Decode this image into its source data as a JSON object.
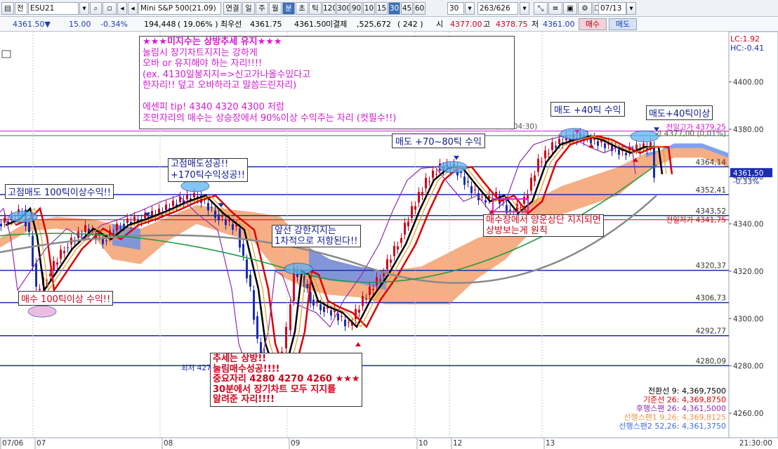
{
  "toolbar": {
    "symbol": "ESU21",
    "mode": "전",
    "product": "Mini S&P 500(21.09)",
    "menu": [
      "연결",
      "일",
      "주",
      "월",
      "분",
      "초",
      "틱"
    ],
    "intervals": [
      "120",
      "300",
      "90",
      "10",
      "15",
      "30",
      "45",
      "60"
    ],
    "interval_selected": "30",
    "period_select": "30",
    "count": "263/626",
    "date": "07/13"
  },
  "quote": {
    "price": "4361.50▼",
    "change": "15.00",
    "change_pct": "-0.34%",
    "volume": "194,448",
    "vol_ratio": "19.06%",
    "best_label": "최우선",
    "best_price": "4361.75",
    "last": "4361.50",
    "unsettled_label": "미결제",
    "unsettled": ",525,672",
    "unsettled_chg": "242",
    "open_label": "시",
    "open": "4377.00",
    "high_label": "고",
    "high": "4378.75",
    "low_label": "저",
    "low": "4361.00",
    "buy_label": "매수",
    "sell_label": "매도"
  },
  "indicators_corner": {
    "lc": "LC:1.92",
    "hc": "HC:-0.41"
  },
  "chart_data": {
    "type": "candlestick",
    "y_axis": {
      "ticks": [
        "4400.00",
        "4380.00",
        "4360.00",
        "4340.00",
        "4320.00",
        "4300.00",
        "4280.00",
        "4260.00"
      ],
      "ylim": [
        4252,
        4407
      ]
    },
    "x_axis": {
      "labels": [
        "07/06",
        "07",
        "08",
        "09",
        "10",
        "12",
        "13"
      ],
      "time": "21:30:00"
    },
    "current": {
      "price": "4361,50",
      "pct": "-0.33%"
    },
    "levels": [
      {
        "label": "4364,14",
        "value": 4364.14
      },
      {
        "label": "4352,41",
        "value": 4352.41
      },
      {
        "label": "4343,52",
        "value": 4343.52
      },
      {
        "label": "4320,37",
        "value": 4320.37
      },
      {
        "label": "4306,73",
        "value": 4306.73
      },
      {
        "label": "4292,77",
        "value": 4292.77
      },
      {
        "label": "4280,09",
        "value": 4280.09
      }
    ],
    "prev_low": {
      "label": "전일저가 4341,75",
      "value": 4341.75
    },
    "prev_high": {
      "label": "전일고가 4379,25",
      "value": 4379.25
    },
    "session_high": {
      "label": "4379,25 (04:30)"
    },
    "session_low": {
      "label": "최저 4273,25 (21:00)"
    },
    "close_marker": {
      "label": "가 4377,00 (0,01%)"
    },
    "legend": [
      {
        "name": "전환선 9: 4,369,7500",
        "color": "#000000"
      },
      {
        "name": "기준선 26: 4,369,8750",
        "color": "#e00000"
      },
      {
        "name": "후행스팬 26: 4,361,5000",
        "color": "#8c2fb0"
      },
      {
        "name": "선행스팬1 9,26: 4,369,8125",
        "color": "#f0944d"
      },
      {
        "name": "선행스팬2 52,26: 4,361,3750",
        "color": "#3d6fe0"
      }
    ]
  },
  "notes": {
    "main": [
      "★★★미지수는 상방추세 유지★★★",
      "눌림시 장기차트지지는 강하게",
      "오바 or 유지해야 하는 자리!!!!",
      "(ex. 4130일봉지지=>신고가나올수있다고",
      "한자리!! 덮고 오바하라고 말씀드린자리)",
      "",
      "에센피 tip! 4340 4320 4300 처럼",
      "조만자리의 매수는 상승장에서 90%이상 수익주는 자리 (컷필수!!)"
    ],
    "a": "고점매도 100틱이상수익!!",
    "b": "고점매도성공!!",
    "b2": "+170틱수익성공!!",
    "c": "매수 100틱이상 수익!!",
    "d": "앞선 강한지지는",
    "d2": "1차적으로 저항된다!!",
    "e": "매도 +70~80틱 수익",
    "f": "매도 +40틱 수익",
    "g": "매도+40틱이상",
    "h": "매수장에서 양운상단 지지되면",
    "h2": "상방보는게 원칙",
    "i": [
      "추세는 상방!!",
      "눌림매수성공!!!!",
      "중요자리 4280 4270 4260  ★★★",
      "30분에서 장기차트 모두 지지를",
      "알려준 자리!!!!"
    ]
  }
}
